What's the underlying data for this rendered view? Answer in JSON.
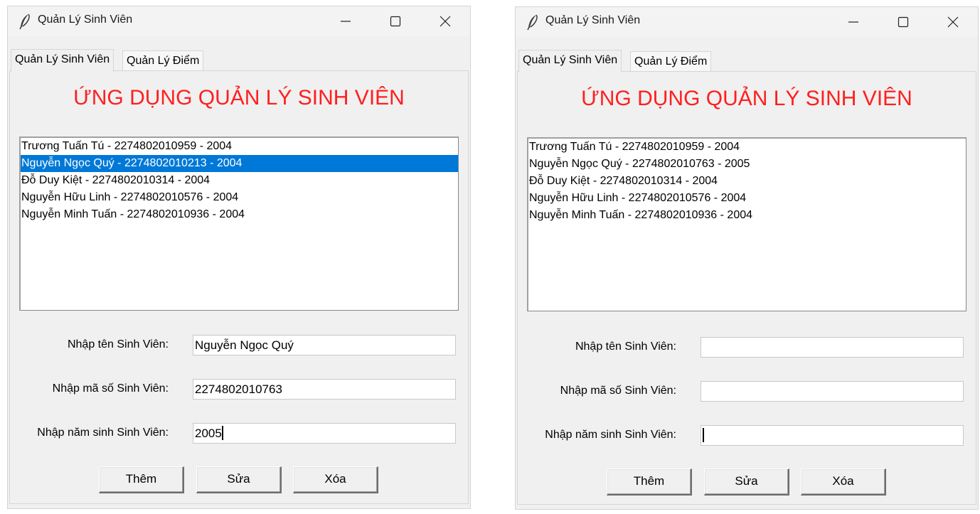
{
  "windows": [
    {
      "title": "Quản Lý Sinh Viên",
      "tabs": [
        "Quản Lý Sinh Viên",
        "Quản Lý Điểm"
      ],
      "heading": "ỨNG DỤNG QUẢN LÝ SINH VIÊN",
      "students": [
        "Trương Tuấn Tú - 2274802010959 - 2004",
        "Nguyễn Ngọc Quý - 2274802010213 - 2004",
        "Đỗ Duy Kiệt - 2274802010314 - 2004",
        "Nguyễn Hữu Linh - 2274802010576 - 2004",
        "Nguyễn Minh Tuấn  - 2274802010936 - 2004"
      ],
      "selected_index": 1,
      "labels": {
        "name": "Nhập tên Sinh Viên:",
        "id": "Nhập mã số Sinh Viên:",
        "year": "Nhập năm sinh Sinh Viên:"
      },
      "inputs": {
        "name": "Nguyễn Ngọc Quý",
        "id": "2274802010763",
        "year": "2005"
      },
      "buttons": {
        "add": "Thêm",
        "edit": "Sửa",
        "delete": "Xóa"
      }
    },
    {
      "title": "Quản Lý Sinh Viên",
      "tabs": [
        "Quản Lý Sinh Viên",
        "Quản Lý Điểm"
      ],
      "heading": "ỨNG DỤNG QUẢN LÝ SINH VIÊN",
      "students": [
        "Trương Tuấn Tú - 2274802010959 - 2004",
        "Nguyễn Ngọc Quý - 2274802010763 - 2005",
        "Đỗ Duy Kiệt - 2274802010314 - 2004",
        "Nguyễn Hữu Linh - 2274802010576 - 2004",
        "Nguyễn Minh Tuấn  - 2274802010936 - 2004"
      ],
      "selected_index": -1,
      "labels": {
        "name": "Nhập tên Sinh Viên:",
        "id": "Nhập mã số Sinh Viên:",
        "year": "Nhập năm sinh Sinh Viên:"
      },
      "inputs": {
        "name": "",
        "id": "",
        "year": ""
      },
      "buttons": {
        "add": "Thêm",
        "edit": "Sửa",
        "delete": "Xóa"
      }
    }
  ],
  "colors": {
    "heading": "#ff1f1f",
    "selection": "#0078d7",
    "window_bg": "#f0f0f0"
  },
  "icons": {
    "app": "feather-icon",
    "minimize": "minimize-icon",
    "maximize": "maximize-icon",
    "close": "close-icon"
  }
}
